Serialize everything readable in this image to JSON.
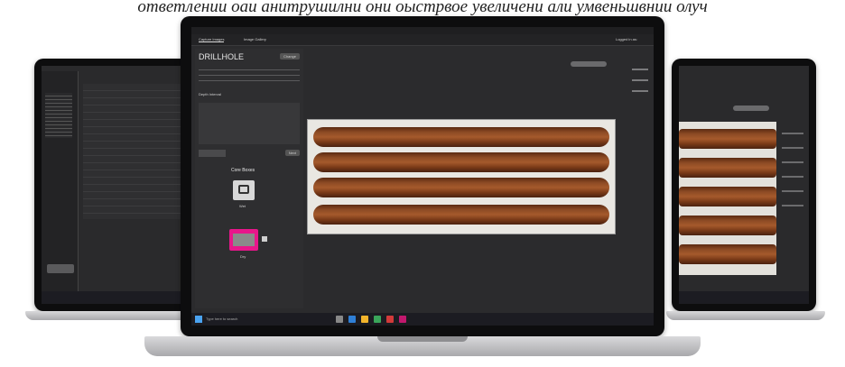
{
  "caption": "ответлении оаи анитрушилни они оыстрвое увеличени али умвеньшвнии олуч",
  "app": {
    "tabs": [
      "Capture Images",
      "Image Gallery"
    ],
    "logged_in": "Logged in as: ",
    "panel_title": "DRILLHOLE",
    "change_button": "Change",
    "depth_section": "Depth Interval",
    "core_boxes_title": "Core Boxes",
    "wet_label": "Wet",
    "dry_label": "Dry",
    "next_button": "Next"
  },
  "taskbar": {
    "search_placeholder": "Type here to search"
  }
}
